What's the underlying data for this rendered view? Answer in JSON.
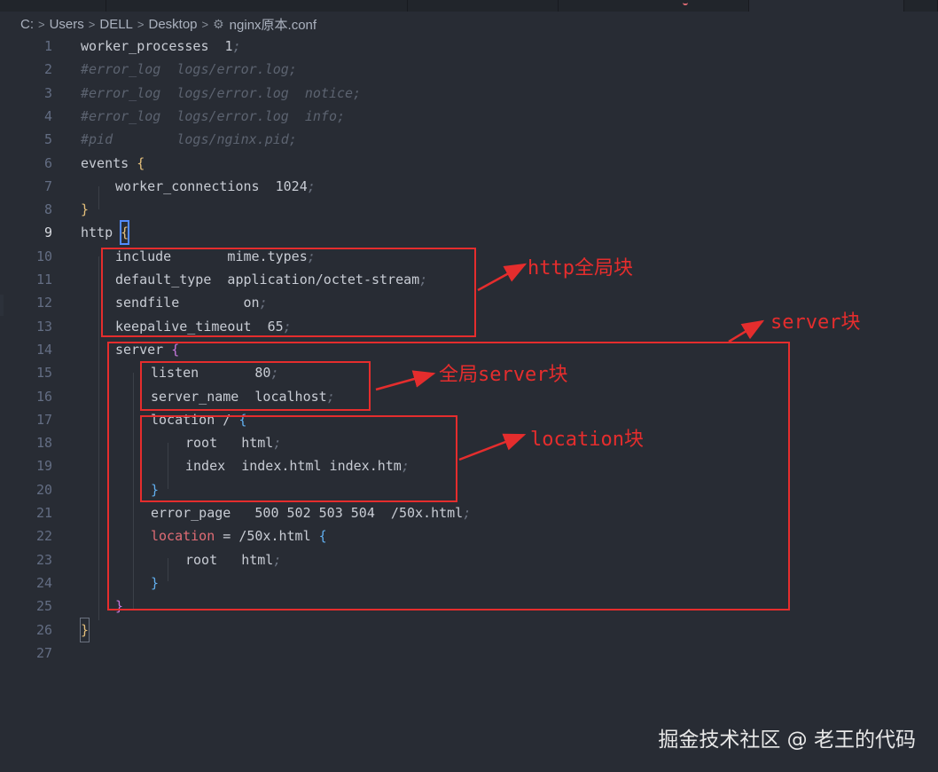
{
  "breadcrumb": {
    "parts": [
      "C:",
      "Users",
      "DELL",
      "Desktop"
    ],
    "file_icon": "gear-icon",
    "file": "nginx原本.conf"
  },
  "code_lines": [
    [
      "worker_processes  1",
      ";"
    ],
    [
      "#error_log  logs/error.log;"
    ],
    [
      "#error_log  logs/error.log  notice;"
    ],
    [
      "#error_log  logs/error.log  info;"
    ],
    [
      "#pid        logs/nginx.pid;"
    ],
    [
      "events ",
      "{"
    ],
    [
      "worker_connections  1024",
      ";"
    ],
    [
      "}"
    ],
    [
      "http ",
      "{"
    ],
    [
      "include       mime.types",
      ";"
    ],
    [
      "default_type  application/octet-stream",
      ";"
    ],
    [
      "sendfile        on",
      ";"
    ],
    [
      "keepalive_timeout  65",
      ";"
    ],
    [
      "server ",
      "{"
    ],
    [
      "listen       80",
      ";"
    ],
    [
      "server_name  localhost",
      ";"
    ],
    [
      "location / ",
      "{"
    ],
    [
      "root   html",
      ";"
    ],
    [
      "index  index.html index.htm",
      ";"
    ],
    [
      "}"
    ],
    [
      "error_page   500 502 503 504  /50x.html",
      ";"
    ],
    [
      "location",
      " = /50x.html ",
      "{"
    ],
    [
      "root   html",
      ";"
    ],
    [
      "}"
    ],
    [
      "}"
    ],
    [
      "}"
    ],
    [
      ""
    ]
  ],
  "line_numbers": [
    "1",
    "2",
    "3",
    "4",
    "5",
    "6",
    "7",
    "8",
    "9",
    "10",
    "11",
    "12",
    "13",
    "14",
    "15",
    "16",
    "17",
    "18",
    "19",
    "20",
    "21",
    "22",
    "23",
    "24",
    "25",
    "26",
    "27"
  ],
  "annotations": {
    "http_block": "http全局块",
    "server_block": "server块",
    "global_server_block": "全局server块",
    "location_block": "location块"
  },
  "watermark": "掘金技术社区 @ 老王的代码",
  "colors": {
    "background": "#282c34",
    "annotation": "#e52d2d",
    "keyword_purple": "#c678dd",
    "brace_yellow": "#e5c07b",
    "brace_blue": "#61afef",
    "comment": "#5c6370"
  }
}
